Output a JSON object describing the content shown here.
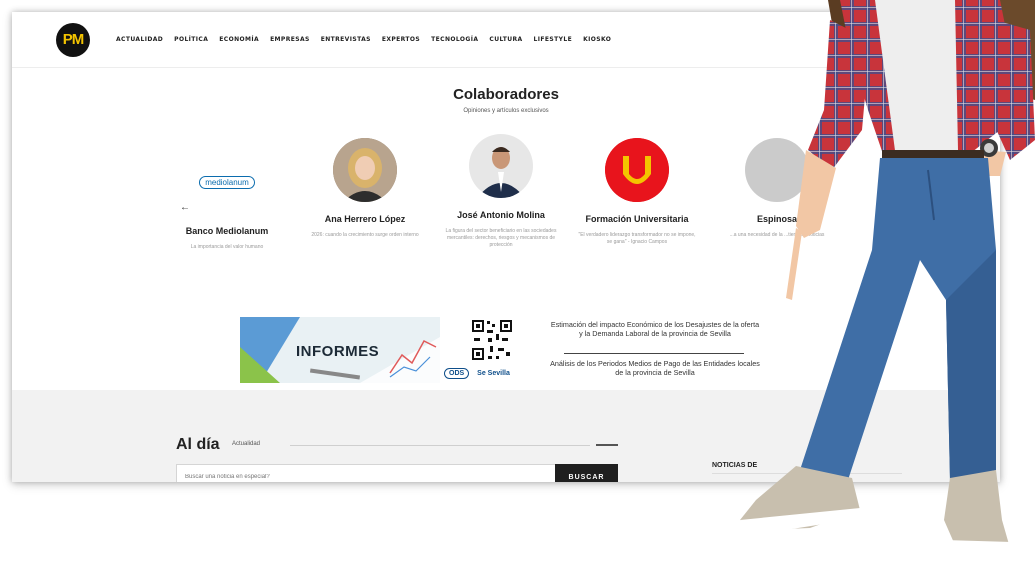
{
  "logo": {
    "text": "PM"
  },
  "nav": {
    "items": [
      "ACTUALIDAD",
      "POLÍTICA",
      "ECONOMÍA",
      "EMPRESAS",
      "ENTREVISTAS",
      "EXPERTOS",
      "TECNOLOGÍA",
      "CULTURA",
      "LIFESTYLE",
      "KIOSKO"
    ]
  },
  "collaborators": {
    "title": "Colaboradores",
    "subtitle": "Opiniones y artículos exclusivos",
    "prev_arrow": "←",
    "next_arrow": "→",
    "cards": [
      {
        "name": "Banco Mediolanum",
        "desc": "La importancia del valor humano",
        "logo_text": "mediolanum"
      },
      {
        "name": "Ana Herrero López",
        "desc": "2026: cuando la crecimiento surge orden interno"
      },
      {
        "name": "José Antonio Molina",
        "desc": "La figura del sector beneficiario en las sociedades mercantiles: derechos, riesgos y mecanismos de protección"
      },
      {
        "name": "Formación Universitaria",
        "desc": "\"El verdadero liderazgo transformador no se impone, se gana\" - Ignacio Campos",
        "logo_text": "U"
      },
      {
        "name": "Espinosa",
        "desc": "...a una necesidad de la ...tiene en noticias"
      }
    ]
  },
  "reports": {
    "banner_label": "INFORMES",
    "report_1": "Estimación del impacto Económico de los Desajustes de la oferta y la Demanda Laboral de la provincia de Sevilla",
    "report_2": "Análisis de los Periodos Medios de Pago de las Entidades locales de la provincia de Sevilla",
    "partner_logos": [
      "ODS",
      "Se Sevilla"
    ]
  },
  "al_dia": {
    "title": "Al día",
    "subtitle": "Actualidad",
    "search_placeholder": "Buscar una noticia en especial?",
    "search_button": "BUSCAR"
  },
  "sidebar": {
    "heading": "NOTICIAS DE"
  },
  "colors": {
    "logo_yellow": "#f4c400",
    "mediolanum_blue": "#0b6cae",
    "univ_red": "#e8141c",
    "shirt_red": "#c8343b",
    "jeans_blue": "#3f6ea6"
  }
}
